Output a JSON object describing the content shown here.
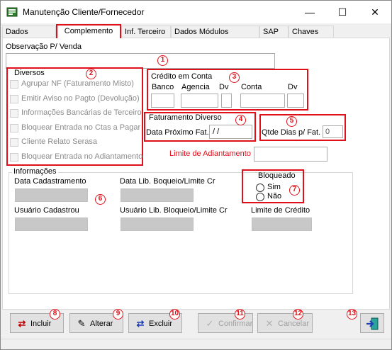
{
  "window": {
    "title": "Manutenção Cliente/Fornecedor",
    "minimize": "—",
    "maximize": "☐",
    "close": "✕"
  },
  "tabs": [
    "Dados Gerais",
    "Complemento",
    "Inf. Terceiro",
    "Dados Módulos Clientes",
    "SAP",
    "Chaves Pix"
  ],
  "observacao": {
    "label": "Observação P/ Venda",
    "value": ""
  },
  "diversos": {
    "title": "Diversos",
    "items": [
      "Agrupar NF (Faturamento Misto)",
      "Emitir Aviso no Pagto (Devolução)",
      "Informações Bancárias de Terceiro",
      "Bloquear Entrada no Ctas a Pagar",
      "Cliente Relato Serasa",
      "Bloquear Entrada no Adiantamento"
    ]
  },
  "credito": {
    "title": "Crédito em Conta",
    "banco": "Banco",
    "agencia": "Agencia",
    "dv1": "Dv",
    "conta": "Conta",
    "dv2": "Dv"
  },
  "faturamento": {
    "title": "Faturamento Diverso",
    "label": "Data Próximo Fat.",
    "value": " / /"
  },
  "qtde": {
    "label": "Qtde Dias p/ Fat.",
    "value": "0"
  },
  "limite_adiantamento": {
    "label": "Limite de Adiantamento",
    "value": ""
  },
  "informacoes": {
    "title": "Informações",
    "data_cadastramento": "Data Cadastramento",
    "data_lib": "Data Lib. Boqueio/Limite Cr",
    "usuario_cadastrou": "Usuário Cadastrou",
    "usuario_lib": "Usuário Lib. Bloqueio/Limite Cr",
    "limite_credito": "Limite de Crédito"
  },
  "bloqueado": {
    "title": "Bloqueado",
    "sim": "Sim",
    "nao": "Não"
  },
  "buttons": {
    "incluir": "Incluir",
    "alterar": "Alterar",
    "excluir": "Excluir",
    "confirmar": "Confirmar",
    "cancelar": "Cancelar"
  },
  "markers": [
    "1",
    "2",
    "3",
    "4",
    "5",
    "6",
    "7",
    "8",
    "9",
    "10",
    "11",
    "12",
    "13"
  ],
  "colors": {
    "annotation": "#e0101a",
    "window_bg": "#f0f0f0",
    "field_gray": "#c8c8c8"
  }
}
